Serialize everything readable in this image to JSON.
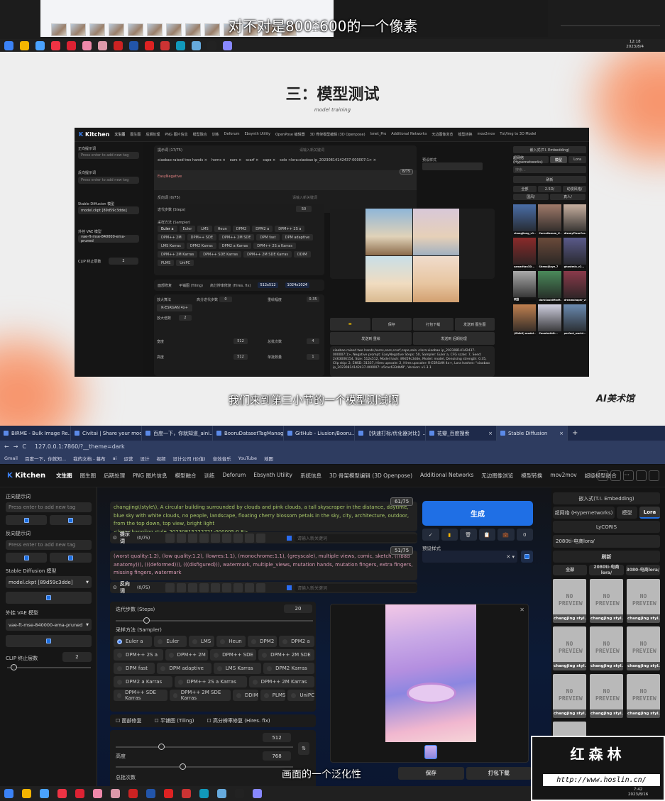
{
  "top_strip": {
    "thumbnail_count": 13,
    "window_label": "全部图片",
    "subtitle": "对不对是800*600的一个像素",
    "taskbar_time": "12:18",
    "taskbar_date": "2023/8/4"
  },
  "slide": {
    "title": "三：模型测试",
    "subtitle_en": "model training",
    "caption": "我们来到第三小节的一个模型测试啊",
    "logo": "AI美术馆",
    "accent": "#f59a6a"
  },
  "mini_ui": {
    "brand": "Kitchen",
    "nav": [
      "文生图",
      "图生图",
      "后期处理",
      "PNG 图片信息",
      "模型融合",
      "训练",
      "Deforum",
      "Ebsynth Utility",
      "OpenPose 编辑器",
      "3D 骨架模型编辑 (3D Openpose)",
      "Isnet_Pro",
      "Additional Networks",
      "无边图像浏览",
      "模型转换",
      "mov2mov",
      "Txt/Img to 3D Model"
    ],
    "left_labels": [
      "正向提示词",
      "反向提示词",
      "Stable Diffusion 模型",
      "外挂 VAE 模型",
      "CLIP 终止层数"
    ],
    "tag_placeholder": "Press enter to add new tag",
    "model": "model.ckpt [89d59c3dde]",
    "vae": "vae-ft-mse-840000-ema-pruned",
    "clip": "2",
    "prompt_label": "提示词",
    "prompt_count": "(17/75)",
    "tags": [
      "xiaobao raised two hands ×",
      "horns ×",
      "ears ×",
      "scarf ×",
      "cape ×",
      "solo <lora:xiaobao ip_20230814142437-000007:1> ×"
    ],
    "neg_count": "8/75",
    "neg_prompt": "EasyNegative",
    "neg_label": "反向词",
    "neg_label_count": "(0/75)",
    "keyword_placeholder": "请输入新关键词",
    "steps_label": "迭代步数 (Steps)",
    "steps": "50",
    "sampler_label": "采样方法 (Sampler)",
    "samplers": [
      "Euler a",
      "Euler",
      "LMS",
      "Heun",
      "DPM2",
      "DPM2 a",
      "DPM++ 2S a",
      "DPM++ 2M",
      "DPM++ SDE",
      "DPM++ 2M SDE",
      "DPM fast",
      "DPM adaptive",
      "LMS Karras",
      "DPM2 Karras",
      "DPM2 a Karras",
      "DPM++ 2S a Karras",
      "DPM++ 2M Karras",
      "DPM++ SDE Karras",
      "DPM++ 2M SDE Karras",
      "DDIM",
      "PLMS",
      "UniPC"
    ],
    "checks": [
      "面部修复",
      "平铺图 (Tiling)",
      "高分辨率修复 (Hires. fix)"
    ],
    "hires_from": "512x512",
    "hires_to": "1024x1024",
    "upscaler_label": "放大算法",
    "upscaler": "R-ESRGAN 4x+",
    "hires_steps_label": "高分迭代步数",
    "hires_steps": "0",
    "denoise_label": "重绘幅度",
    "denoise": "0.35",
    "scale_label": "放大倍数",
    "scale": "2",
    "width_label": "宽度",
    "width": "512",
    "height_label": "高度",
    "height": "512",
    "batch_count_label": "总批次数",
    "batch_count": "4",
    "batch_size_label": "单批数量",
    "batch_size": "1",
    "preset_label": "预设样式",
    "output_buttons": [
      "保存",
      "打包下载",
      "发送到 图生图",
      "发送到 重绘",
      "发送到 后期处理"
    ],
    "info": "xiaobao raised two hands,horns,ears,scarf,cape,solo <lora:xiaobao ip_20230814142437-000007:1>, Negative prompt: EasyNegative Steps: 50, Sampler: Euler a, CFG scale: 7, Seed: 2463006154, Size: 512x512, Model hash: 89d59c3dde, Model: model, Denoising strength: 0.35, Clip skip: 2, ENSD: 31337, Hires upscale: 2, Hires upscaler: R-ESRGAN 4x+, Lora hashes: \"xiaobao ip_20230814142437-000007: a5cac633dbf8\", Version: v1.3.1",
    "right_embed": "嵌入式(T.I. Embedding)",
    "right_tabs": [
      "超网络 (Hypernetworks)",
      "模型",
      "Lora"
    ],
    "right_search": "搜索...",
    "refresh": "刷新",
    "filters": [
      "全部",
      "2.5D/",
      "动漫风格/",
      "国风/",
      "真人/"
    ],
    "gallery_captions": [
      "changjiang_v1...",
      "Cornelianum_V...",
      "disneyPixarCar...",
      "samaritan3D...",
      "ShenaiJiaye_7",
      "ghostmix_v2...",
      "校园",
      "darkSushiMixM...",
      "dreamshaper_v5...",
      "(Ghibli) model...",
      "Counterfeit...",
      "perfect_world..."
    ]
  },
  "browser": {
    "tabs": [
      "BIRME - Bulk Image Re...",
      "Civitai | Share your mod...",
      "百度一下，你就知道_aini...",
      "BooruDatasetTagManag...",
      "GitHub - Liusion/Booru...",
      "【快速打标/优化器对比】...",
      "花瓣_百度搜索",
      "Stable Diffusion"
    ],
    "active_tab": 7,
    "url": "127.0.0.1:7860/?__theme=dark",
    "bookmarks": [
      "Gmail",
      "百度一下，你就知...",
      "我的文档 - 幕布",
      "ai",
      "运营",
      "设计",
      "视频",
      "设计公司 (价值)",
      "音效音乐",
      "YouTube",
      "地图"
    ]
  },
  "app": {
    "brand": "Kitchen",
    "nav": [
      "文生图",
      "图生图",
      "后期处理",
      "PNG 图片信息",
      "模型融合",
      "训练",
      "Deforum",
      "Ebsynth Utility",
      "系统信息",
      "3D 骨架模型编辑 (3D Openpose)",
      "Additional Networks",
      "无边图像浏览",
      "模型转换",
      "mov2mov",
      "超级模型融合",
      "···"
    ],
    "header_icons": [
      "theme-icon",
      "b-icon",
      "github-icon",
      "settings-icon",
      "hand-icon"
    ],
    "left": {
      "pos_label": "正向提示词",
      "neg_label": "反向提示词",
      "tag_placeholder": "Press enter to add new tag",
      "sd_label": "Stable Diffusion 模型",
      "sd_model": "model.ckpt [89d59c3dde]",
      "vae_label": "外挂 VAE 模型",
      "vae": "vae-ft-mse-840000-ema-pruned",
      "clip_label": "CLIP 终止层数",
      "clip": "2",
      "clip_fraction": 0.08
    },
    "prompt": {
      "count": "61/75",
      "text_green": "changjing\\(style\\), A circular building surrounded by clouds and pink clouds, a tall skyscraper in the distance, daytime, blue sky with white clouds, no people, landscape, floating cherry blossom petals in the sky, city, architecture, outdoor, from the top down, top view, bright light",
      "text_lora": "<lora:changjing style_20230815222721-000005:0.8>",
      "label": "提示词",
      "label_count": "(0/75)",
      "keyword_placeholder": "请输入新关键词"
    },
    "negative": {
      "count": "51/75",
      "text": "(worst quality:1.2), (low quality:1.2), (lowres:1.1), (monochrome:1.1), (greyscale), multiple views, comic, sketch, (((bad anatomy))), (((deformed))), (((disfigured))), watermark, multiple_views, mutation hands, mutation fingers, extra fingers, missing fingers, watermark",
      "label": "反向词",
      "label_count": "(0/75)",
      "keyword_placeholder": "请输入新关键词"
    },
    "generate": "生成",
    "tool_buttons": [
      "✓",
      "▮",
      "🗑",
      "📋",
      "💼",
      "0"
    ],
    "preset_label": "预设样式",
    "steps_label": "迭代步数 (Steps)",
    "steps": "20",
    "steps_fraction": 0.14,
    "sampler_label": "采样方法 (Sampler)",
    "samplers": [
      "Euler a",
      "Euler",
      "LMS",
      "Heun",
      "DPM2",
      "DPM2 a",
      "DPM++ 2S a",
      "DPM++ 2M",
      "DPM++ SDE",
      "DPM++ 2M SDE",
      "DPM fast",
      "DPM adaptive",
      "LMS Karras",
      "DPM2 Karras",
      "DPM2 a Karras",
      "DPM++ 2S a Karras",
      "DPM++ 2M Karras",
      "DPM++ SDE Karras",
      "DPM++ 2M SDE Karras",
      "DDIM",
      "PLMS",
      "UniPC"
    ],
    "selected_sampler": "Euler a",
    "checks": [
      "面部修复",
      "平铺图 (Tiling)",
      "高分辨率修复 (Hires. fix)"
    ],
    "width": "512",
    "height_label": "高度",
    "height": "768",
    "batch_count_label": "总批次数",
    "swap": "⇅",
    "output_buttons": [
      "保存",
      "打包下载"
    ],
    "right": {
      "embed": "嵌入式(T.I. Embedding)",
      "tabs": [
        "超网络 (Hypernetworks)",
        "模型",
        "Lora"
      ],
      "active_tab": 2,
      "lycoris": "LyCORIS",
      "search_value": "2080ti-电商lora/",
      "refresh": "刷新",
      "filters": [
        "全部",
        "2080ti-电商lora/",
        "3080-电商lora/"
      ],
      "card_preview": "NO PREVIEW",
      "card_caption": "changjing styl..."
    },
    "subtitle": "画面的一个泛化性",
    "accent": "#1f6fe5"
  },
  "watermark": {
    "name": "红森林",
    "url": "http://www.hoslin.cn/"
  },
  "bottom_taskbar": {
    "time": "7:42",
    "date": "2023/8/16"
  }
}
